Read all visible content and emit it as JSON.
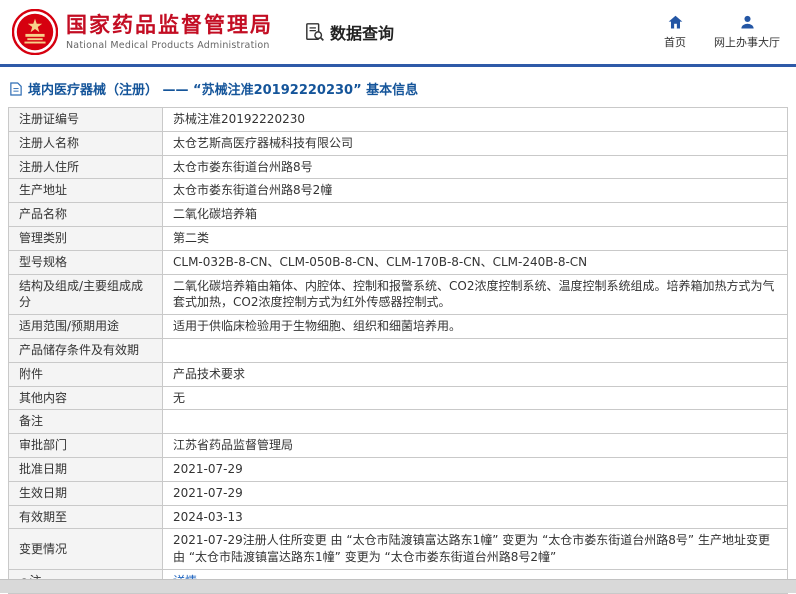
{
  "header": {
    "agency_name": "国家药品监督管理局",
    "agency_name_en": "National Medical Products Administration",
    "query_title": "数据查询",
    "nav_home": "首页",
    "nav_hall": "网上办事大厅"
  },
  "page": {
    "title": "境内医疗器械（注册） —— “苏械注准20192220230” 基本信息"
  },
  "colors": {
    "accent_blue": "#2e5aa8",
    "agency_red": "#c30d23",
    "link_blue": "#2166c0",
    "label_bg": "#f4f4f4"
  },
  "note": {
    "bullet": "●"
  },
  "table": {
    "rows": [
      {
        "label": "注册证编号",
        "value": "苏械注准20192220230"
      },
      {
        "label": "注册人名称",
        "value": "太仓艺斯高医疗器械科技有限公司"
      },
      {
        "label": "注册人住所",
        "value": "太仓市娄东街道台州路8号"
      },
      {
        "label": "生产地址",
        "value": "太仓市娄东街道台州路8号2幢"
      },
      {
        "label": "产品名称",
        "value": "二氧化碳培养箱"
      },
      {
        "label": "管理类别",
        "value": "第二类"
      },
      {
        "label": "型号规格",
        "value": "CLM-032B-8-CN、CLM-050B-8-CN、CLM-170B-8-CN、CLM-240B-8-CN"
      },
      {
        "label": "结构及组成/主要组成成分",
        "value": "二氧化碳培养箱由箱体、内腔体、控制和报警系统、CO2浓度控制系统、温度控制系统组成。培养箱加热方式为气套式加热，CO2浓度控制方式为红外传感器控制式。"
      },
      {
        "label": "适用范围/预期用途",
        "value": "适用于供临床检验用于生物细胞、组织和细菌培养用。"
      },
      {
        "label": "产品储存条件及有效期",
        "value": ""
      },
      {
        "label": "附件",
        "value": "产品技术要求"
      },
      {
        "label": "其他内容",
        "value": "无"
      },
      {
        "label": "备注",
        "value": ""
      },
      {
        "label": "审批部门",
        "value": "江苏省药品监督管理局"
      },
      {
        "label": "批准日期",
        "value": "2021-07-29"
      },
      {
        "label": "生效日期",
        "value": "2021-07-29"
      },
      {
        "label": "有效期至",
        "value": "2024-03-13"
      },
      {
        "label": "变更情况",
        "value": "2021-07-29注册人住所变更 由 “太仓市陆渡镇富达路东1幢” 变更为 “太仓市娄东街道台州路8号” 生产地址变更 由 “太仓市陆渡镇富达路东1幢” 变更为 “太仓市娄东街道台州路8号2幢”"
      },
      {
        "label": "注",
        "value": "详情"
      }
    ]
  }
}
